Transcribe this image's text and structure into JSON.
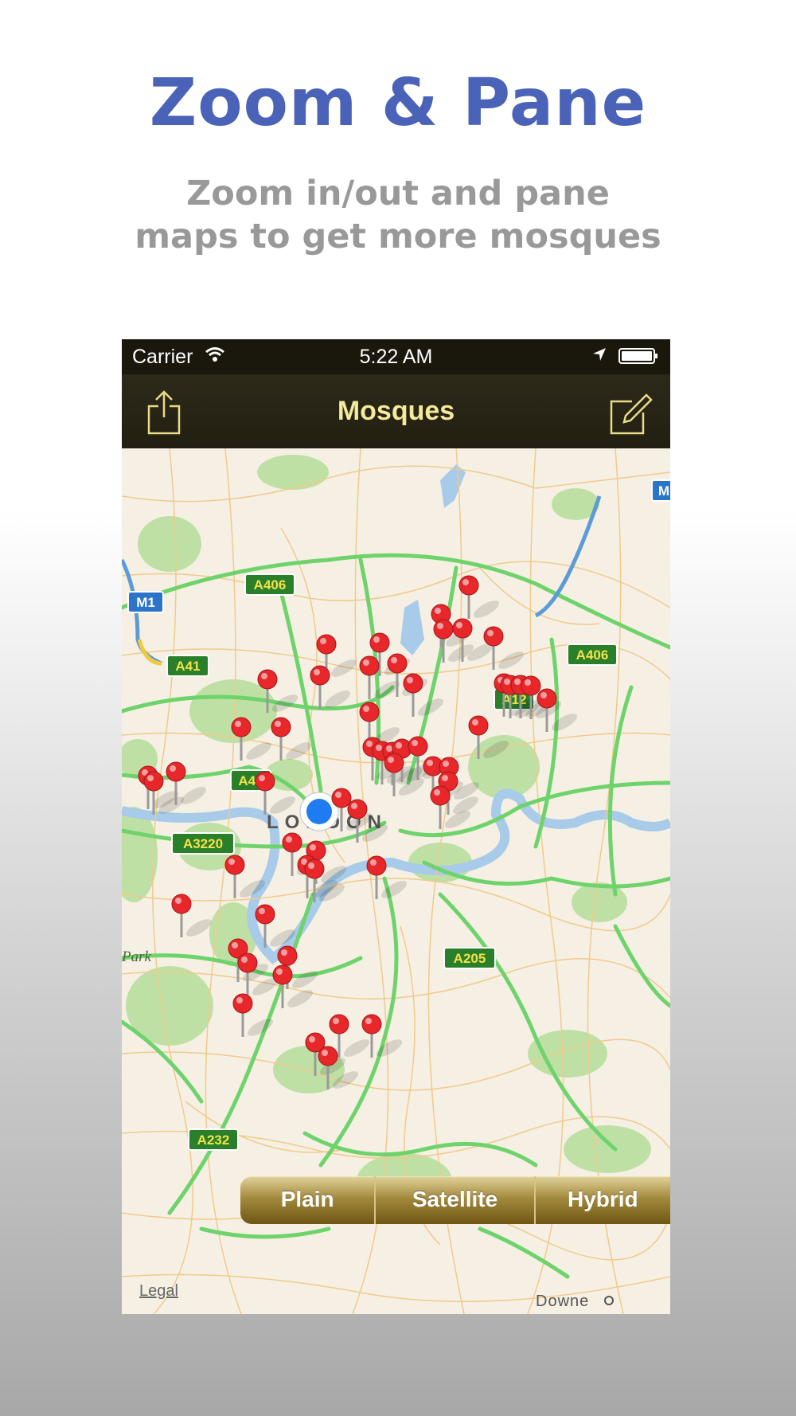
{
  "promo": {
    "headline": "Zoom & Pane",
    "subtitle_line1": "Zoom in/out and pane",
    "subtitle_line2": "maps to get more mosques"
  },
  "status_bar": {
    "carrier": "Carrier",
    "time": "5:22 AM"
  },
  "nav": {
    "title": "Mosques",
    "left_icon": "share-icon",
    "right_icon": "compose-icon"
  },
  "map": {
    "city_label": "LONDON",
    "legal": "Legal",
    "road_labels": [
      "A406",
      "M1",
      "A41",
      "A406",
      "A12",
      "A40",
      "A3220",
      "A205",
      "A232",
      "M"
    ],
    "place_labels": [
      "Park",
      "Downe"
    ],
    "mosque_pin_count": 56
  },
  "map_type": {
    "options": [
      "Plain",
      "Satellite",
      "Hybrid"
    ]
  },
  "colors": {
    "headline": "#4a63b8",
    "subtitle": "#999999",
    "nav_title": "#f4ea9c",
    "pin": "#e8272a",
    "road_green": "#6fd36c"
  }
}
